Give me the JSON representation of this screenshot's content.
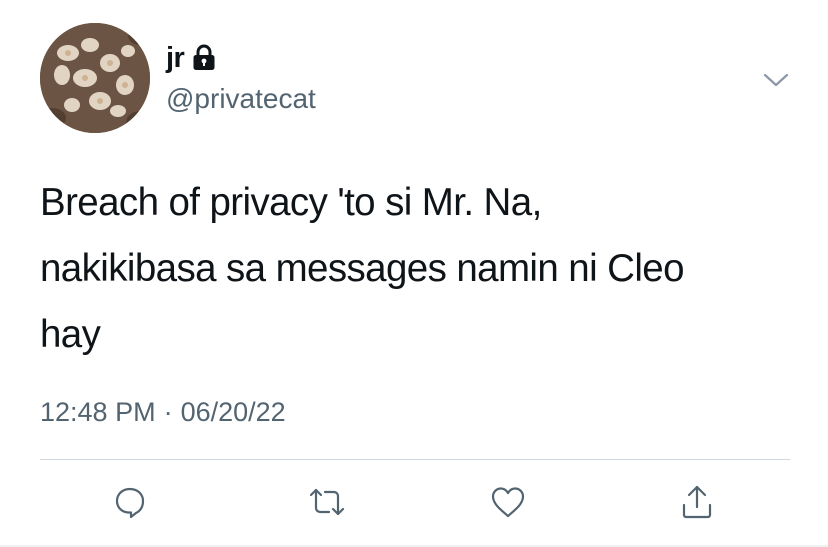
{
  "author": {
    "display_name": "jr",
    "handle": "@privatecat",
    "protected": true
  },
  "tweet": {
    "text_lines": [
      "Breach of privacy 'to si Mr. Na,",
      "nakikibasa sa messages namin ni Cleo",
      "hay"
    ],
    "time": "12:48 PM",
    "separator": "·",
    "date": "06/20/22"
  },
  "icons": {
    "lock": "lock-icon",
    "more": "chevron-down-icon",
    "reply": "reply-icon",
    "retweet": "retweet-icon",
    "like": "heart-icon",
    "share": "share-icon"
  },
  "colors": {
    "text": "#0f1419",
    "secondary": "#536471",
    "divider": "#cfd9de"
  }
}
